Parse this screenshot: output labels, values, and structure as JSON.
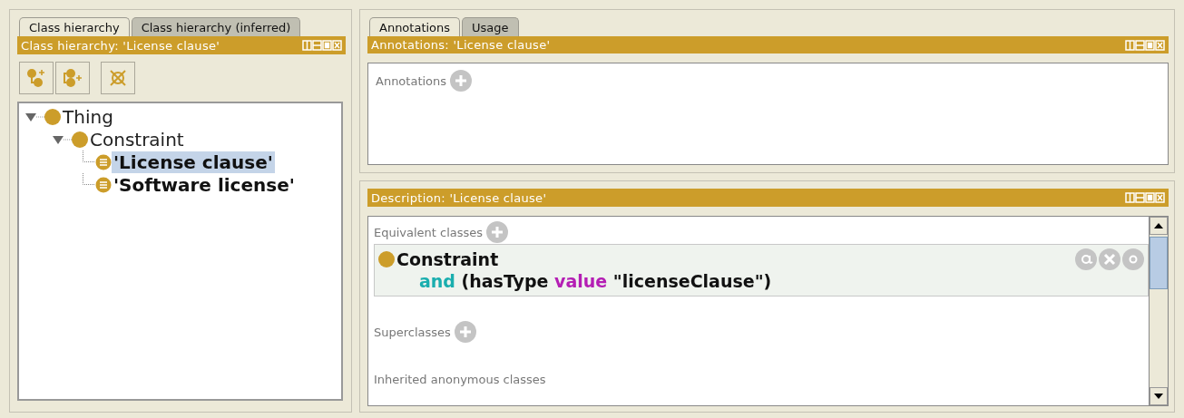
{
  "left": {
    "tabs": [
      {
        "label": "Class hierarchy",
        "selected": true
      },
      {
        "label": "Class hierarchy (inferred)",
        "selected": false
      }
    ],
    "header": "Class hierarchy: 'License clause'",
    "tree": [
      {
        "label": "Thing",
        "kind": "primitive",
        "expanded": true,
        "selected": false,
        "children": [
          {
            "label": "Constraint",
            "kind": "primitive",
            "expanded": true,
            "selected": false,
            "children": [
              {
                "label": "'License clause'",
                "kind": "defined",
                "selected": true
              },
              {
                "label": "'Software license'",
                "kind": "defined",
                "selected": false
              }
            ]
          }
        ]
      }
    ]
  },
  "right": {
    "tabs": [
      {
        "label": "Annotations",
        "selected": true
      },
      {
        "label": "Usage",
        "selected": false
      }
    ],
    "annotations_header": "Annotations: 'License clause'",
    "annotations_label": "Annotations",
    "description_header": "Description: 'License clause'",
    "sections": [
      {
        "label": "Equivalent classes",
        "add_button": true,
        "items": [
          {
            "lines": [
              [
                {
                  "text": "Constraint",
                  "kind": "plain"
                }
              ],
              [
                {
                  "text": "and",
                  "kind": "keyword"
                },
                {
                  "text": " (hasType ",
                  "kind": "plain"
                },
                {
                  "text": "value",
                  "kind": "restriction"
                },
                {
                  "text": " \"licenseClause\")",
                  "kind": "plain"
                }
              ]
            ]
          }
        ]
      },
      {
        "label": "Superclasses",
        "add_button": true
      },
      {
        "label": "Inherited anonymous classes",
        "add_button": false
      }
    ]
  }
}
